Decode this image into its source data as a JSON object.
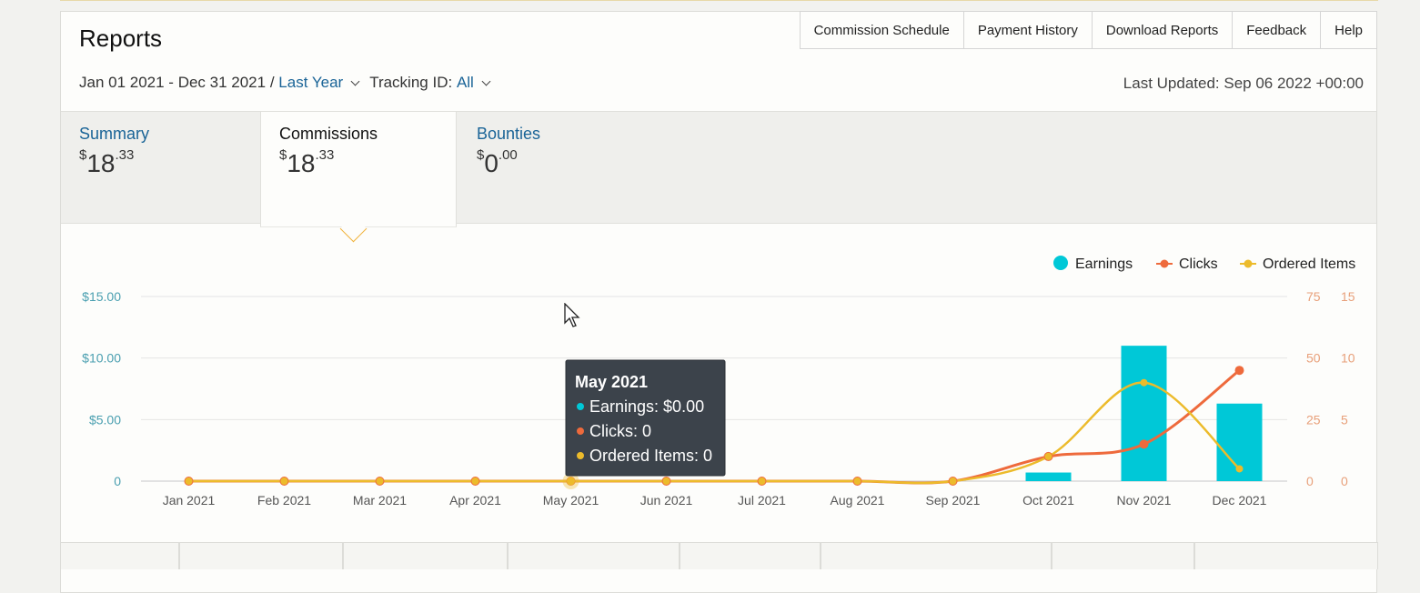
{
  "header": {
    "title": "Reports",
    "tabs": [
      "Commission Schedule",
      "Payment History",
      "Download Reports",
      "Feedback",
      "Help"
    ]
  },
  "filters": {
    "date_range": "Jan 01 2021 - Dec 31 2021 /",
    "period": "Last Year",
    "tracking_label": "Tracking ID:",
    "tracking_value": "All",
    "last_updated": "Last Updated: Sep 06 2022 +00:00"
  },
  "summary": [
    {
      "label": "Summary",
      "currency": "$",
      "whole": "18",
      "cents": ".33"
    },
    {
      "label": "Commissions",
      "currency": "$",
      "whole": "18",
      "cents": ".33"
    },
    {
      "label": "Bounties",
      "currency": "$",
      "whole": "0",
      "cents": ".00"
    }
  ],
  "colors": {
    "earnings": "#00c8d7",
    "clicks": "#ee6a3c",
    "ordered": "#ecbb2b",
    "link": "#1a6497",
    "axis_left": "#4a9fb0",
    "axis_right": "#e8a07a"
  },
  "chart_data": {
    "type": "bar",
    "categories": [
      "Jan 2021",
      "Feb 2021",
      "Mar 2021",
      "Apr 2021",
      "May 2021",
      "Jun 2021",
      "Jul 2021",
      "Aug 2021",
      "Sep 2021",
      "Oct 2021",
      "Nov 2021",
      "Dec 2021"
    ],
    "series": [
      {
        "name": "Earnings",
        "type": "bar",
        "axis": "left",
        "values": [
          0,
          0,
          0,
          0,
          0,
          0,
          0,
          0,
          0,
          0.7,
          11.0,
          6.3
        ]
      },
      {
        "name": "Clicks",
        "type": "line",
        "axis": "right1",
        "values": [
          0,
          0,
          0,
          0,
          0,
          0,
          0,
          0,
          0,
          10,
          15,
          45
        ]
      },
      {
        "name": "Ordered Items",
        "type": "line",
        "axis": "right2",
        "values": [
          0,
          0,
          0,
          0,
          0,
          0,
          0,
          0,
          0,
          2,
          8,
          1
        ]
      }
    ],
    "left_ticks": [
      "0",
      "$5.00",
      "$10.00",
      "$15.00"
    ],
    "right1_ticks": [
      "0",
      "25",
      "50",
      "75"
    ],
    "right2_ticks": [
      "0",
      "5",
      "10",
      "15"
    ],
    "ylim_left": [
      0,
      15
    ],
    "ylim_right1": [
      0,
      75
    ],
    "ylim_right2": [
      0,
      15
    ],
    "legend_position": "top-right",
    "grid": true
  },
  "tooltip": {
    "title": "May 2021",
    "lines": [
      "Earnings: $0.00",
      "Clicks: 0",
      "Ordered Items: 0"
    ]
  }
}
